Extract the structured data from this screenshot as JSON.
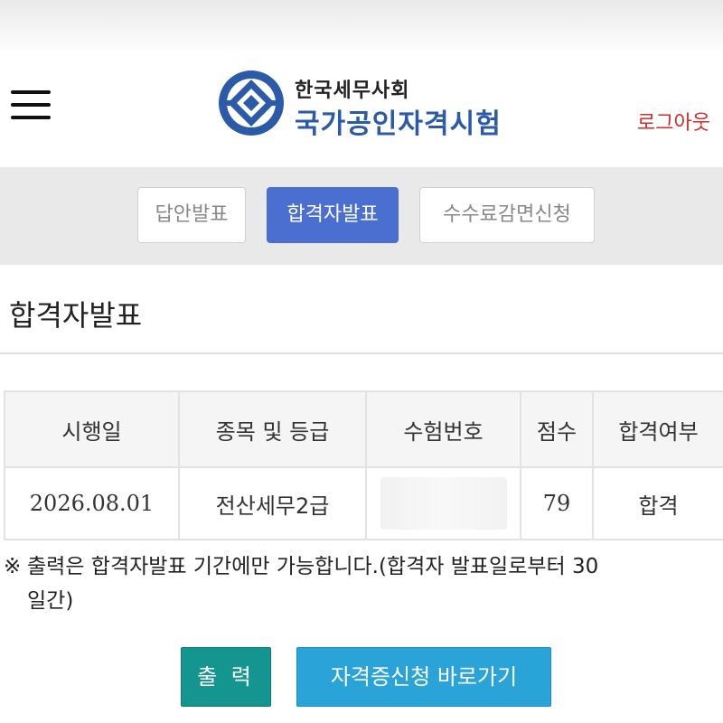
{
  "header": {
    "org_name": "한국세무사회",
    "org_sub": "국가공인자격시험",
    "logout_label": "로그아웃",
    "brand_color": "#2a5aa8",
    "logout_color": "#d42b2b"
  },
  "tabs": [
    {
      "label": "답안발표",
      "active": false
    },
    {
      "label": "합격자발표",
      "active": true
    },
    {
      "label": "수수료감면신청",
      "active": false
    }
  ],
  "section_title": "합격자발표",
  "table": {
    "headers": [
      "시행일",
      "종목 및 등급",
      "수험번호",
      "점수",
      "합격여부"
    ],
    "rows": [
      {
        "date": "2026.08.01",
        "subject": "전산세무2급",
        "exam_no": "",
        "score": "79",
        "result": "합격"
      }
    ]
  },
  "note": {
    "mark": "※",
    "line1": "출력은 합격자발표 기간에만 가능합니다.(합격자 발표일로부터 30",
    "line2": "일간)"
  },
  "buttons": {
    "print_label": "출 력",
    "cert_label": "자격증신청 바로가기",
    "print_color": "#15958f",
    "cert_color": "#2aa4d8"
  },
  "accent_color": "#4b6fd0"
}
